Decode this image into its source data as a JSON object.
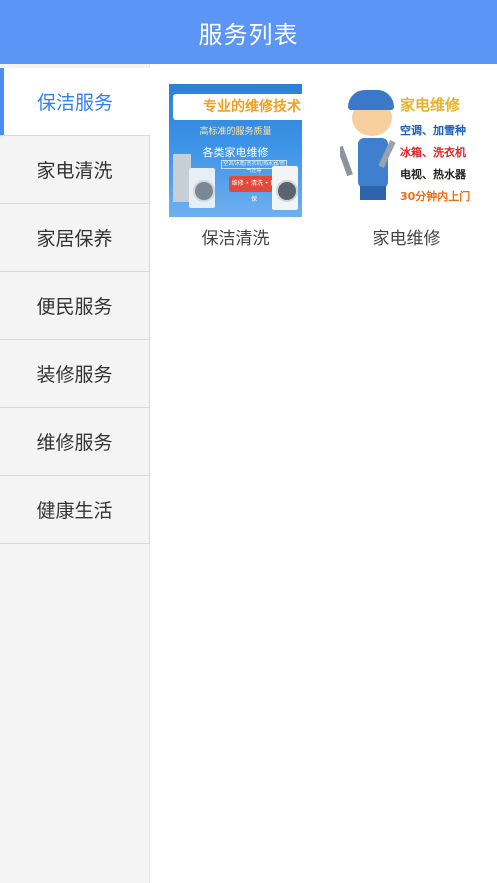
{
  "header": {
    "title": "服务列表"
  },
  "sidebar": {
    "items": [
      {
        "label": "保洁服务",
        "active": true
      },
      {
        "label": "家电清洗",
        "active": false
      },
      {
        "label": "家居保养",
        "active": false
      },
      {
        "label": "便民服务",
        "active": false
      },
      {
        "label": "装修服务",
        "active": false
      },
      {
        "label": "维修服务",
        "active": false
      },
      {
        "label": "健康生活",
        "active": false
      }
    ]
  },
  "content": {
    "cards": [
      {
        "label": "保洁清洗",
        "image": {
          "headline": "专业的维修技术",
          "subline": "高标准的服务质量",
          "caption": "各类家电维修",
          "small_print": "空调/冰箱/洗衣机/热水器/燃气灶等",
          "tag": "维修 • 清洗 • 延保"
        }
      },
      {
        "label": "家电维修",
        "image": {
          "line1": "家电维修",
          "line2": "空调、加雪种",
          "line3": "冰箱、洗衣机",
          "line4": "电视、热水器",
          "line5": "30分钟内上门"
        }
      }
    ]
  },
  "colors": {
    "header_bg": "#5b95f6",
    "active_text": "#2f7ff2",
    "sidebar_bg": "#f4f4f4"
  }
}
